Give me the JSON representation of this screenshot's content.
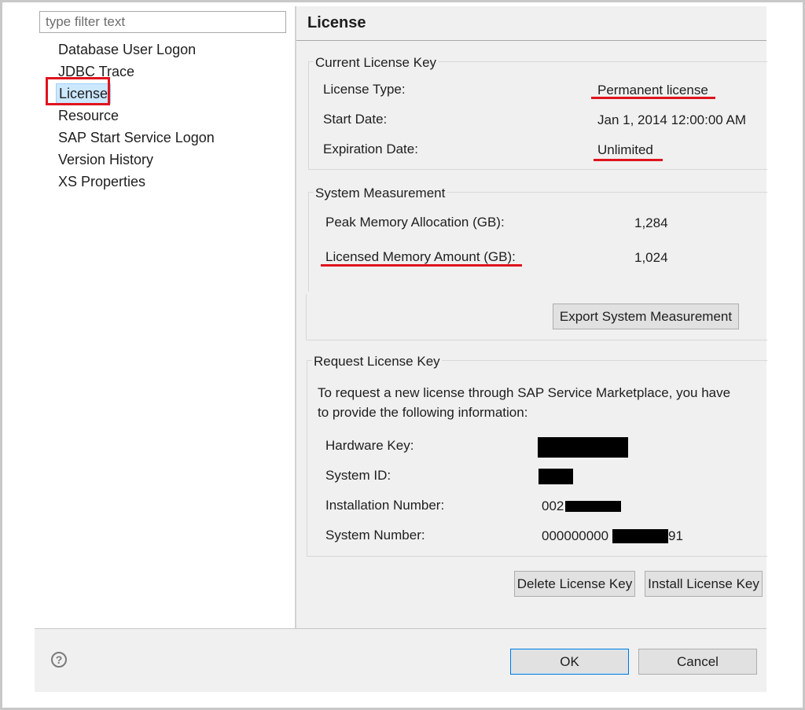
{
  "sidebar": {
    "filter_placeholder": "type filter text",
    "items": [
      {
        "label": "Database User Logon"
      },
      {
        "label": "JDBC Trace"
      },
      {
        "label": "License",
        "selected": true
      },
      {
        "label": "Resource"
      },
      {
        "label": "SAP Start Service Logon"
      },
      {
        "label": "Version History"
      },
      {
        "label": "XS Properties"
      }
    ]
  },
  "page": {
    "title": "License"
  },
  "current_license": {
    "group_label": "Current License Key",
    "type_label": "License Type:",
    "type_value": "Permanent license",
    "start_label": "Start Date:",
    "start_value": "Jan 1, 2014 12:00:00 AM",
    "expiration_label": "Expiration Date:",
    "expiration_value": "Unlimited"
  },
  "system_measurement": {
    "group_label": "System Measurement",
    "peak_label": "Peak Memory Allocation (GB):",
    "peak_value": "1,284",
    "licensed_label": "Licensed Memory Amount (GB):",
    "licensed_value": "1,024",
    "export_button": "Export System Measurement"
  },
  "request_license": {
    "group_label": "Request License Key",
    "description_line1": "To request a new license through SAP Service Marketplace, you have",
    "description_line2": "to provide the following information:",
    "hardware_key_label": "Hardware Key:",
    "system_id_label": "System ID:",
    "installation_number_label": "Installation Number:",
    "installation_number_prefix": "002",
    "system_number_label": "System Number:",
    "system_number_prefix": "000000000",
    "system_number_suffix": "91"
  },
  "actions": {
    "delete_button": "Delete License Key",
    "install_button": "Install License Key"
  },
  "footer": {
    "help_icon": "?",
    "ok_button": "OK",
    "cancel_button": "Cancel"
  },
  "colors": {
    "annotation_red": "#e0141e",
    "selection_bg": "#cce8ff",
    "primary_border": "#0078d7",
    "dialog_bg": "#f0f0f0"
  }
}
